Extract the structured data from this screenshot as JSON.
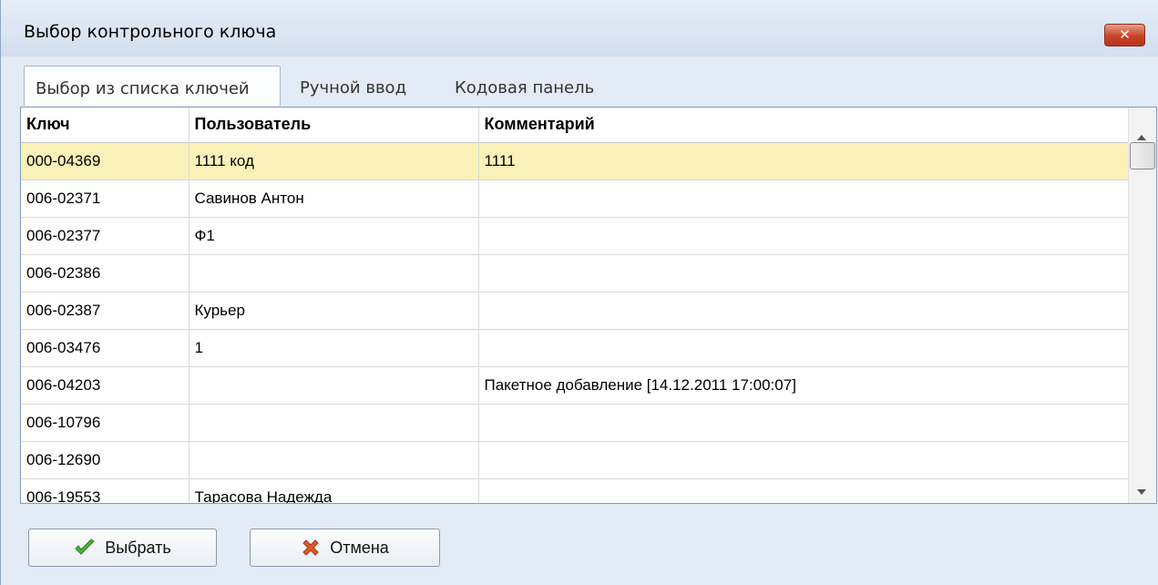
{
  "window": {
    "title": "Выбор контрольного ключа",
    "close_label": "✕"
  },
  "tabs": [
    {
      "label": "Выбор из списка ключей",
      "active": true
    },
    {
      "label": "Ручной ввод",
      "active": false
    },
    {
      "label": "Кодовая панель",
      "active": false
    }
  ],
  "table": {
    "columns": [
      "Ключ",
      "Пользователь",
      "Комментарий"
    ],
    "rows": [
      {
        "key": "000-04369",
        "user": "1111 код",
        "comment": "1111",
        "selected": true
      },
      {
        "key": "006-02371",
        "user": "Савинов Антон",
        "comment": ""
      },
      {
        "key": "006-02377",
        "user": "Ф1",
        "comment": ""
      },
      {
        "key": "006-02386",
        "user": "",
        "comment": ""
      },
      {
        "key": "006-02387",
        "user": "Курьер",
        "comment": ""
      },
      {
        "key": "006-03476",
        "user": "1",
        "comment": ""
      },
      {
        "key": "006-04203",
        "user": "",
        "comment": "Пакетное добавление [14.12.2011 17:00:07]"
      },
      {
        "key": "006-10796",
        "user": "",
        "comment": ""
      },
      {
        "key": "006-12690",
        "user": "",
        "comment": ""
      },
      {
        "key": "006-19553",
        "user": "Тарасова Надежда",
        "comment": ""
      }
    ]
  },
  "buttons": {
    "select_label": "Выбрать",
    "cancel_label": "Отмена"
  },
  "colors": {
    "selected_row": "#faf1b9",
    "title_bar": "#d3dfef",
    "close_button": "#c7432a"
  }
}
